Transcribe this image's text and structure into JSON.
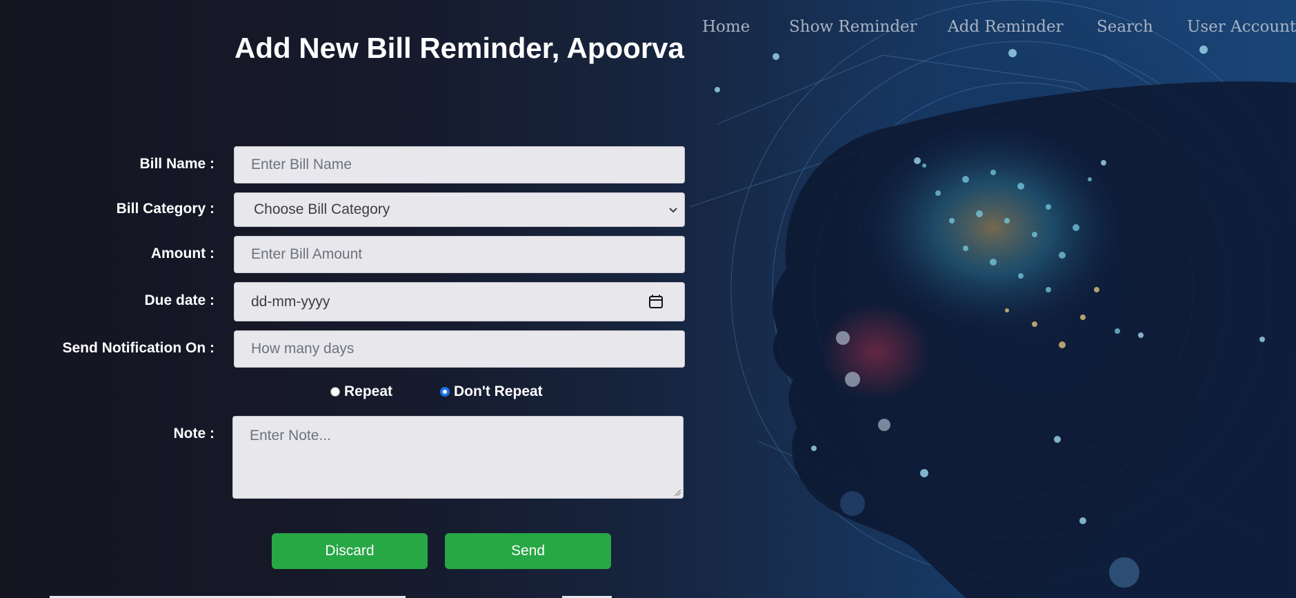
{
  "nav": {
    "items": [
      "Home",
      "Show Reminder",
      "Add Reminder",
      "Search",
      "User Account"
    ]
  },
  "page": {
    "title": "Add New Bill Reminder, Apoorva"
  },
  "form": {
    "bill_name": {
      "label": "Bill Name :",
      "placeholder": "Enter Bill Name"
    },
    "bill_category": {
      "label": "Bill Category :",
      "value": "Choose Bill Category"
    },
    "amount": {
      "label": "Amount :",
      "placeholder": "Enter Bill Amount"
    },
    "due_date": {
      "label": "Due date :",
      "placeholder": "dd-mm-yyyy"
    },
    "notify": {
      "label": "Send Notification On :",
      "placeholder": "How many days"
    },
    "repeat": {
      "options": [
        "Repeat",
        "Don't Repeat"
      ],
      "selected": "Don't Repeat"
    },
    "note": {
      "label": "Note :",
      "placeholder": "Enter Note..."
    }
  },
  "buttons": {
    "discard": "Discard",
    "send": "Send"
  },
  "colors": {
    "button_green": "#28a745",
    "radio_blue": "#1a73e8",
    "background_dark": "#171725",
    "background_blue": "#1a4577"
  },
  "icons": [
    "chevron-down-icon",
    "calendar-icon",
    "resize-grip-icon",
    "ai-head-network-illustration"
  ]
}
